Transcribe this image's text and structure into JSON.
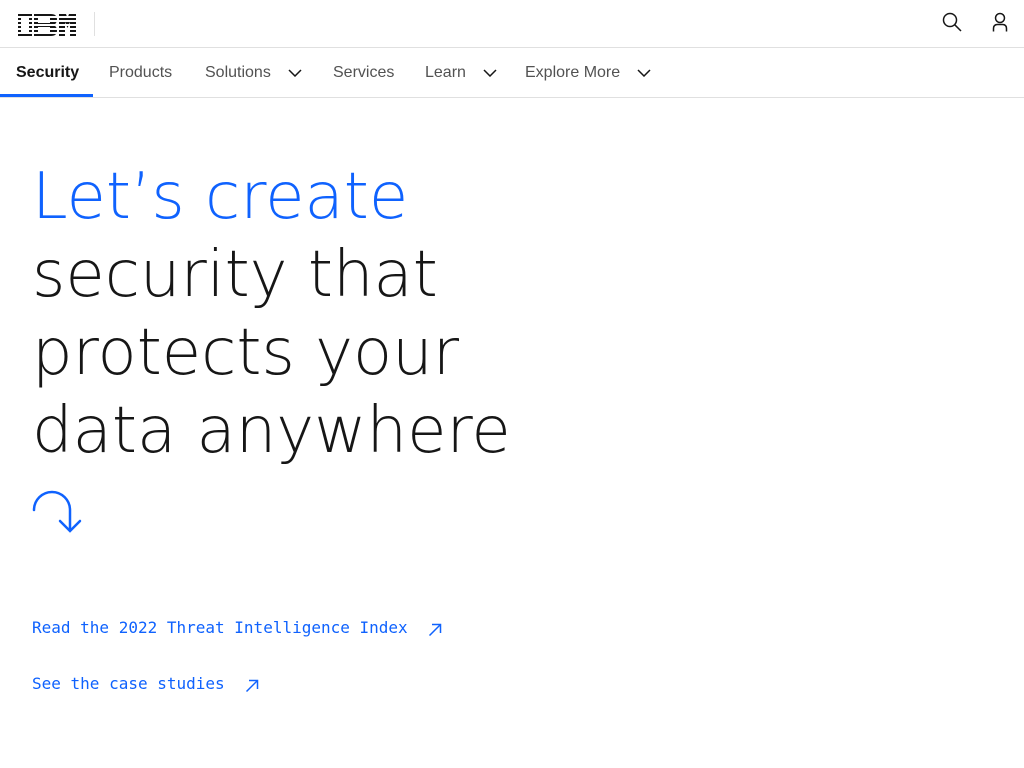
{
  "masthead": {
    "brand": "IBM",
    "brand_color": "#161616",
    "icons": [
      "search-icon",
      "user-icon"
    ]
  },
  "subnav": {
    "items": [
      {
        "label": "Security",
        "active": true,
        "dropdown": false
      },
      {
        "label": "Products",
        "active": false,
        "dropdown": false
      },
      {
        "label": "Solutions",
        "active": false,
        "dropdown": true
      },
      {
        "label": "Services",
        "active": false,
        "dropdown": false
      },
      {
        "label": "Learn",
        "active": false,
        "dropdown": true
      },
      {
        "label": "Explore More",
        "active": false,
        "dropdown": true
      }
    ]
  },
  "hero": {
    "line1": "Let’s create",
    "line2": "security that",
    "line3": "protects your",
    "line4": "data anywhere",
    "accent_color": "#0f62fe"
  },
  "links": [
    {
      "label": "Read the 2022 Threat Intelligence Index",
      "icon": "arrow-up-right-icon"
    },
    {
      "label": "See the case studies",
      "icon": "arrow-up-right-icon"
    }
  ]
}
